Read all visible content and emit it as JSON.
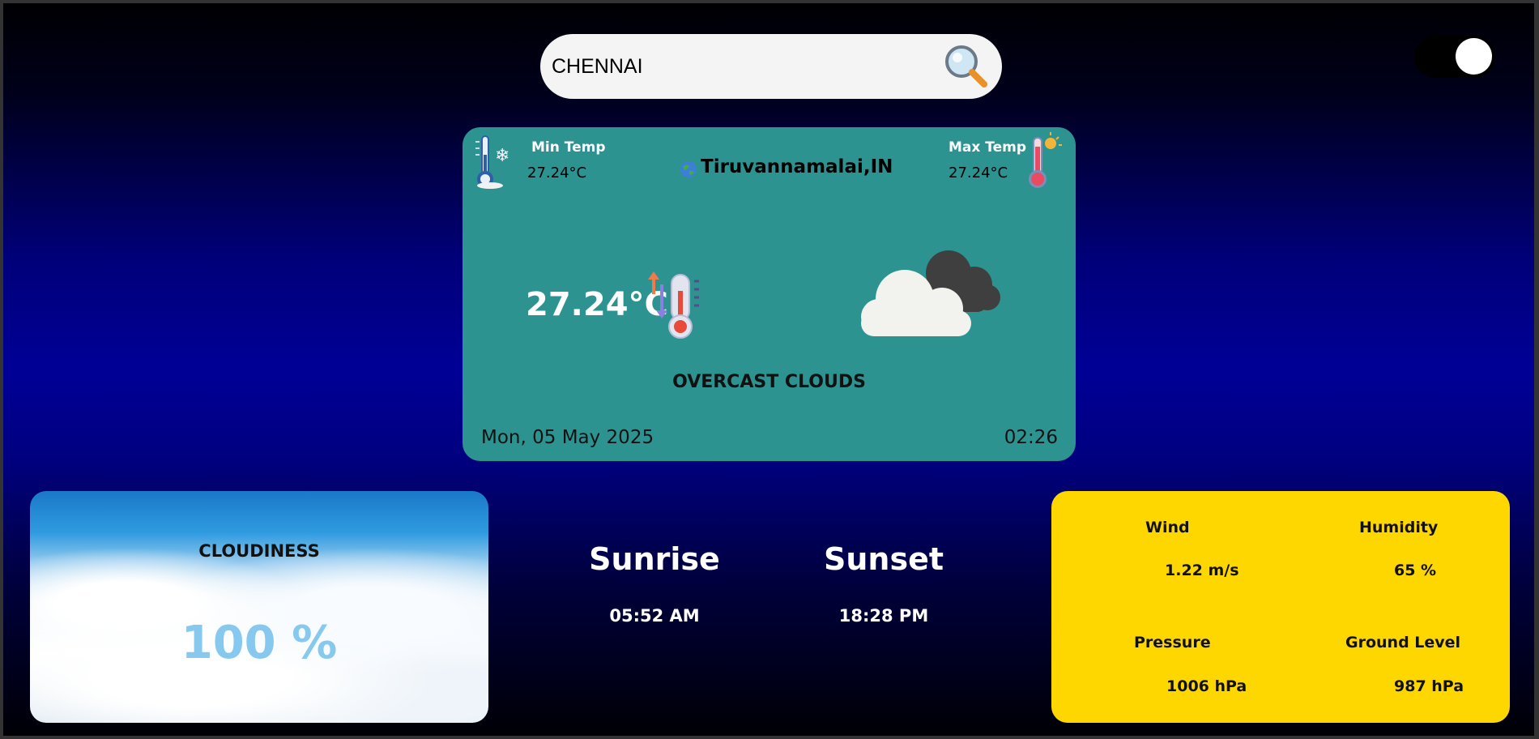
{
  "search": {
    "value": "CHENNAI",
    "icon": "search-icon"
  },
  "theme_toggle": {
    "state": "on"
  },
  "weather": {
    "min_temp_label": "Min Temp",
    "min_temp_value": "27.24°C",
    "max_temp_label": "Max Temp",
    "max_temp_value": "27.24°C",
    "location": "Tiruvannamalai,IN",
    "current_temp": "27.24°C",
    "description": "OVERCAST CLOUDS",
    "date": "Mon, 05 May 2025",
    "time": "02:26"
  },
  "cloudiness": {
    "title": "CLOUDINESS",
    "value": "100 %"
  },
  "sun": {
    "sunrise_label": "Sunrise",
    "sunrise_time": "05:52 AM",
    "sunset_label": "Sunset",
    "sunset_time": "18:28 PM"
  },
  "stats": {
    "wind_label": "Wind",
    "wind_value": "1.22 m/s",
    "humidity_label": "Humidity",
    "humidity_value": "65 %",
    "pressure_label": "Pressure",
    "pressure_value": "1006 hPa",
    "ground_label": "Ground Level",
    "ground_value": "987 hPa"
  },
  "colors": {
    "card": "#2d9391",
    "stats_card": "#ffd700",
    "cloudiness_value": "#87c9ee"
  }
}
